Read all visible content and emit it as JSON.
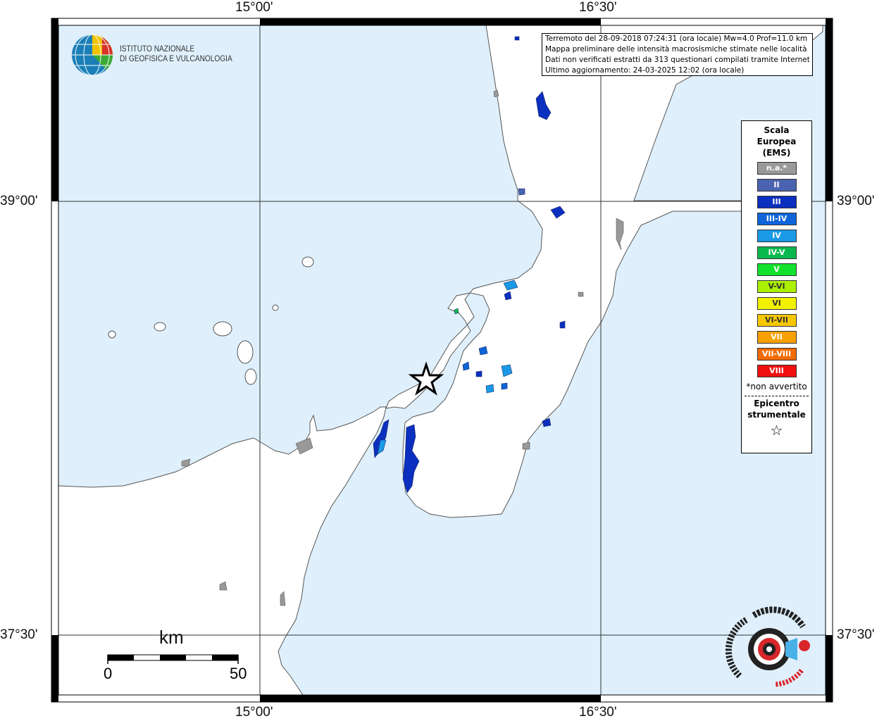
{
  "map": {
    "ticks": {
      "lon_left": "15°00'",
      "lon_right": "16°30'",
      "lat_upper": "39°00'",
      "lat_lower": "37°30'"
    },
    "info": {
      "line1": "Terremoto del 28-09-2018 07:24:31 (ora locale) Mw=4.0 Prof=11.0 km",
      "line2": "Mappa preliminare delle intensità macrosismiche stimate nelle località",
      "line3": "Dati non verificati estratti da 313 questionari compilati tramite Internet.",
      "line4": "Ultimo aggiornamento: 24-03-2025 12:02 (ora locale)"
    },
    "ingv": {
      "line1": "ISTITUTO NAZIONALE",
      "line2": "DI GEOFISICA E VULCANOLOGIA"
    },
    "legend": {
      "title_line1": "Scala",
      "title_line2": "Europea",
      "title_line3": "(EMS)",
      "items": [
        {
          "label": "n.a.*",
          "color": "#999999"
        },
        {
          "label": "II",
          "color": "#4a63b0"
        },
        {
          "label": "III",
          "color": "#0b2fbf"
        },
        {
          "label": "III-IV",
          "color": "#0e64d8"
        },
        {
          "label": "IV",
          "color": "#1a99e6"
        },
        {
          "label": "IV-V",
          "color": "#0bb84e"
        },
        {
          "label": "V",
          "color": "#12e22e"
        },
        {
          "label": "V-VI",
          "color": "#aaf000"
        },
        {
          "label": "VI",
          "color": "#f2f200"
        },
        {
          "label": "VI-VII",
          "color": "#f7c800"
        },
        {
          "label": "VII",
          "color": "#f7a000"
        },
        {
          "label": "VII-VIII",
          "color": "#f26b00"
        },
        {
          "label": "VIII",
          "color": "#f01010"
        }
      ],
      "note": "*non avvertito",
      "epicenter_line1": "Epicentro",
      "epicenter_line2": "strumentale",
      "epicenter_symbol": "☆"
    },
    "scale_bar": {
      "unit": "km",
      "start": "0",
      "end": "50"
    },
    "colors": {
      "sea": "#dff0fc",
      "land": "#ffffff"
    }
  }
}
